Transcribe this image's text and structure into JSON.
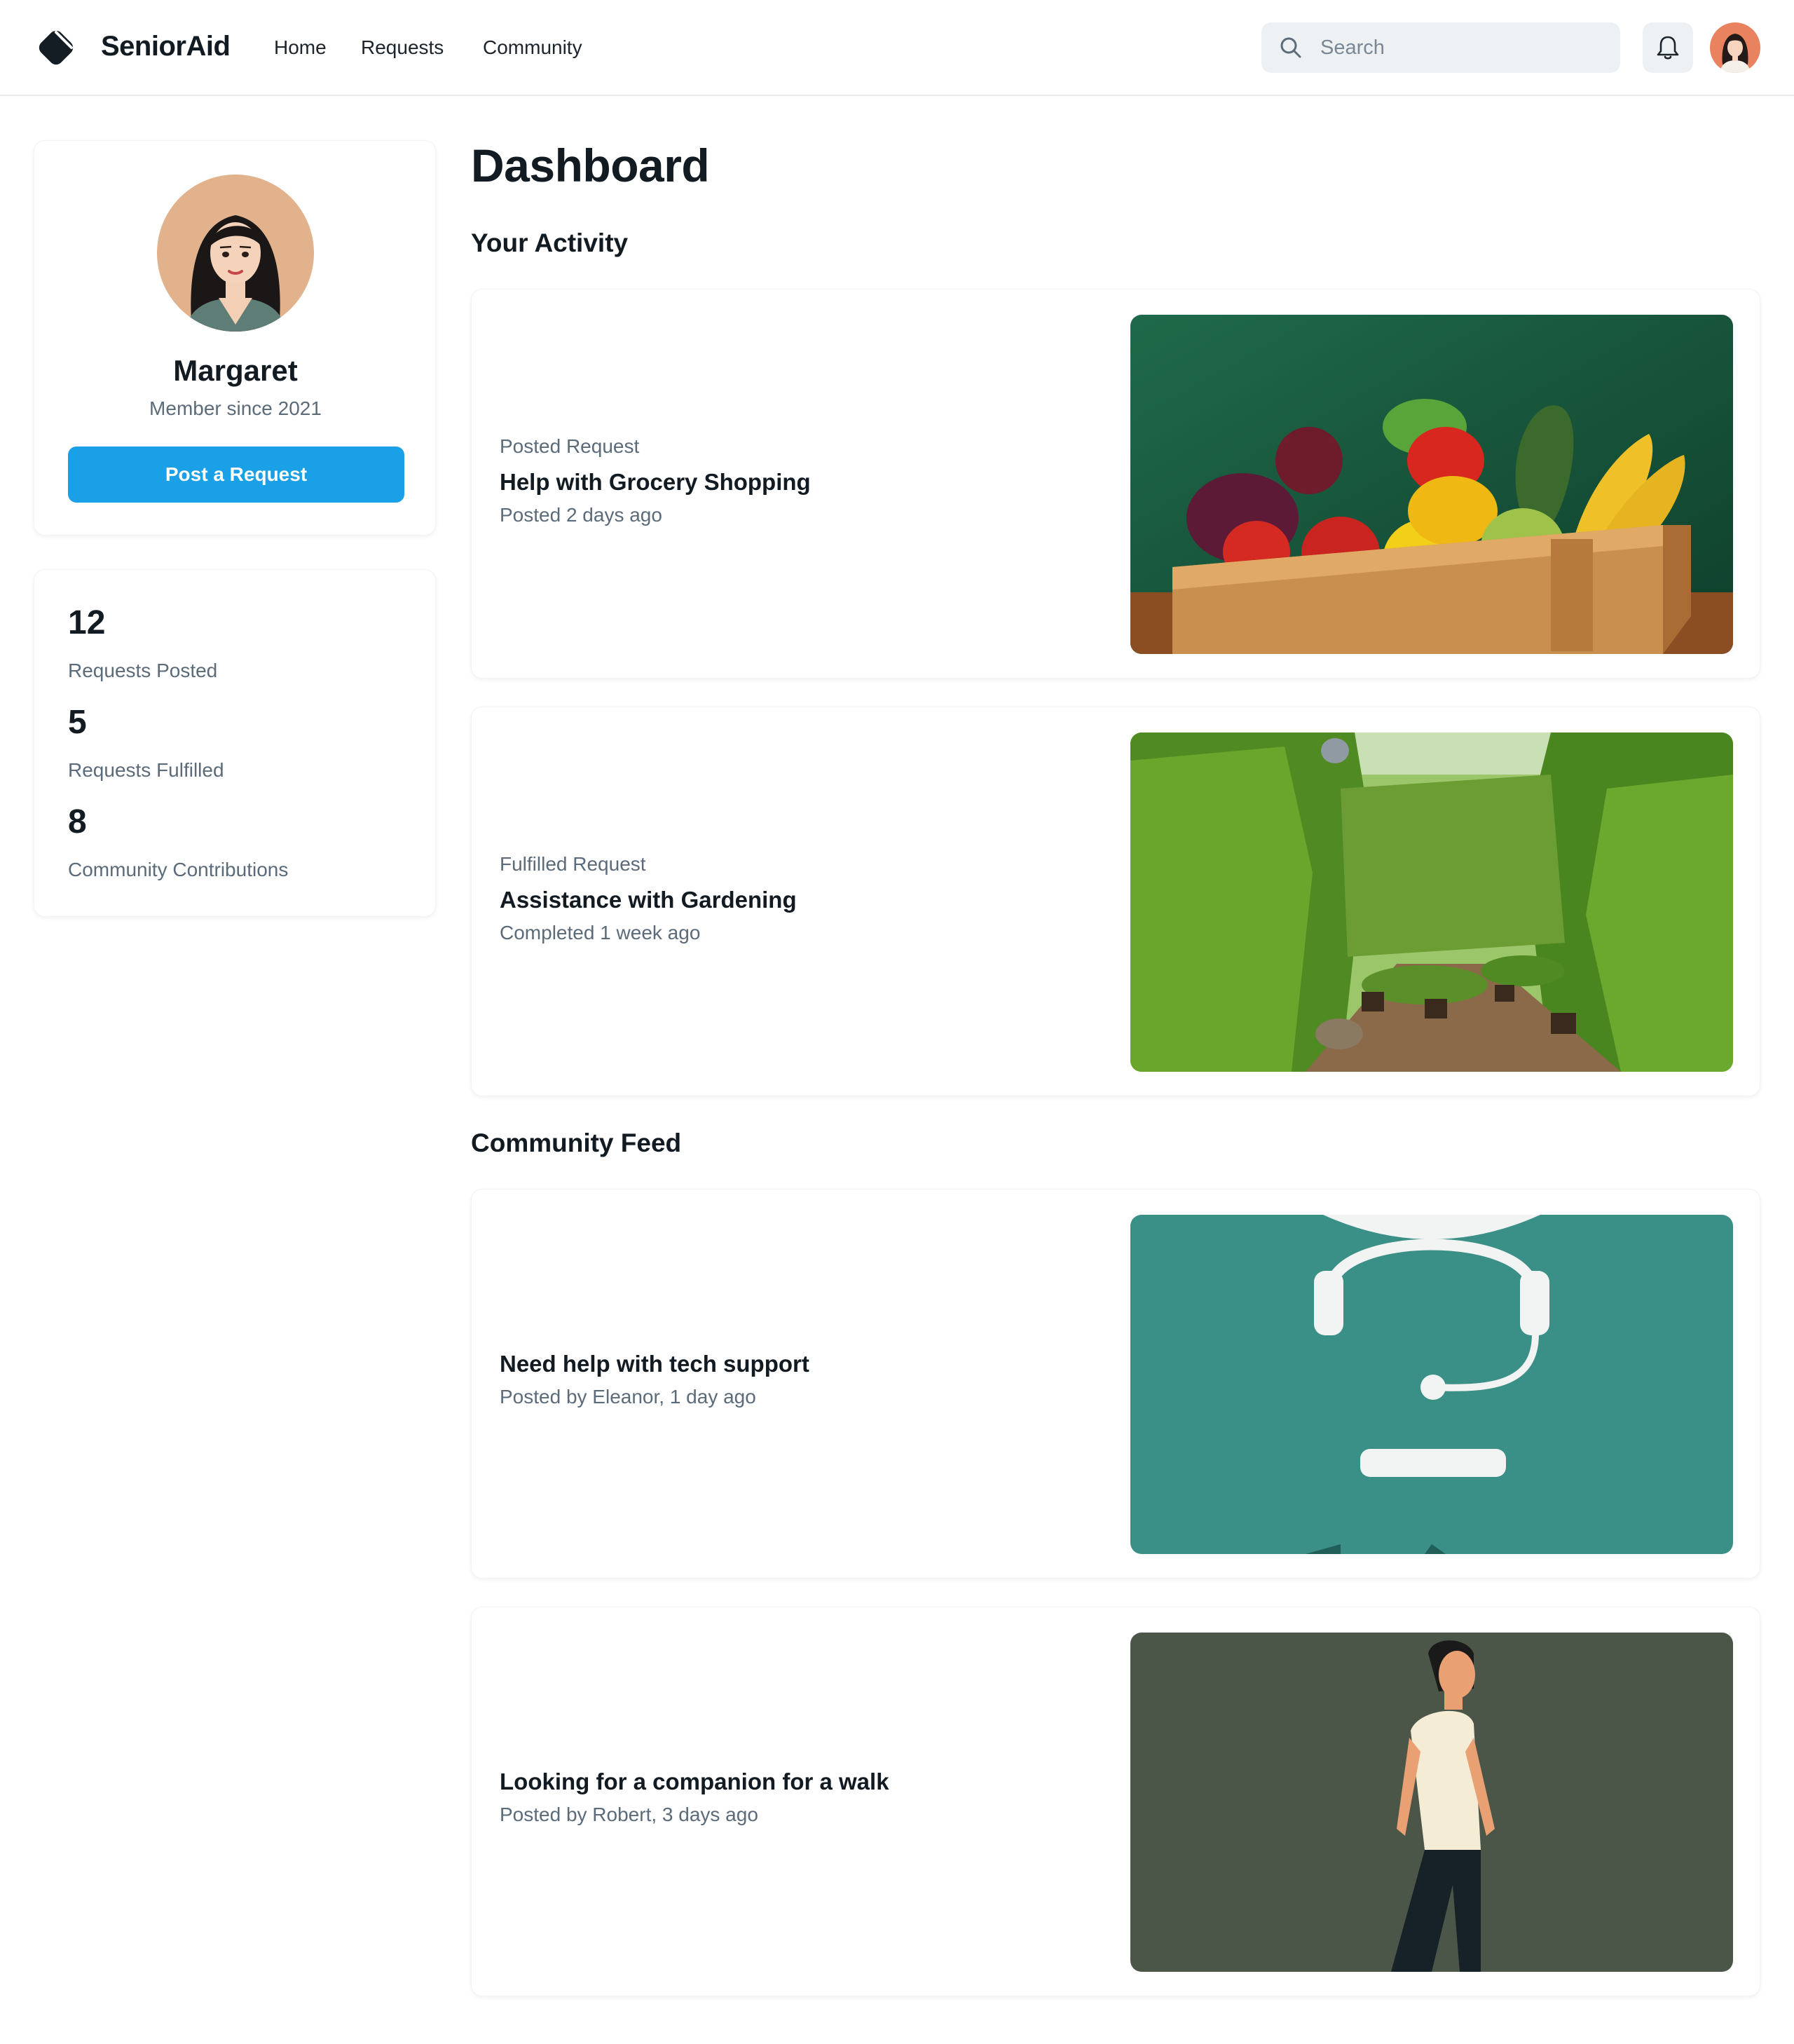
{
  "header": {
    "brand": "SeniorAid",
    "nav": [
      "Home",
      "Requests",
      "Community"
    ],
    "search_placeholder": "Search",
    "icons": [
      "logo-icon",
      "search-icon",
      "bell-icon",
      "user-avatar"
    ]
  },
  "profile": {
    "name": "Margaret",
    "member_since": "Member since 2021",
    "post_button": "Post a Request"
  },
  "stats": [
    {
      "value": "12",
      "label": "Requests Posted"
    },
    {
      "value": "5",
      "label": "Requests Fulfilled"
    },
    {
      "value": "8",
      "label": "Community Contributions"
    }
  ],
  "main": {
    "title": "Dashboard",
    "activity_heading": "Your Activity",
    "feed_heading": "Community Feed"
  },
  "activity": [
    {
      "type": "Posted Request",
      "title": "Help with Grocery Shopping",
      "time": "Posted 2 days ago",
      "image": "grocery-box-image"
    },
    {
      "type": "Fulfilled Request",
      "title": "Assistance with Gardening",
      "time": "Completed 1 week ago",
      "image": "garden-image"
    }
  ],
  "community": [
    {
      "title": "Need help with tech support",
      "byline": "Posted by Eleanor, 1 day ago",
      "image": "headset-image"
    },
    {
      "title": "Looking for a companion for a walk",
      "byline": "Posted by Robert, 3 days ago",
      "image": "walking-man-image"
    }
  ],
  "colors": {
    "accent": "#19a0e6",
    "text": "#121a22",
    "muted": "#5b6b7a",
    "search_bg": "#eef1f3"
  }
}
